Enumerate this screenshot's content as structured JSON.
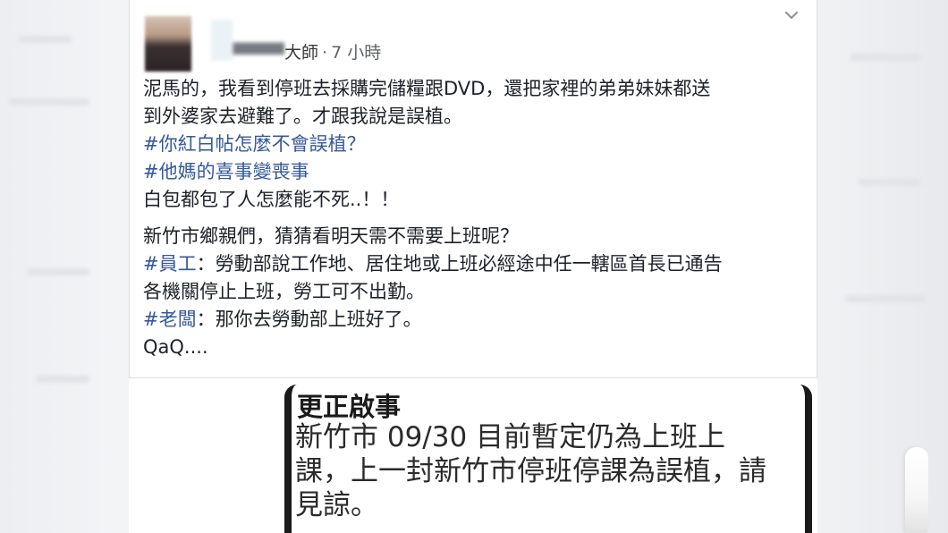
{
  "post": {
    "author_suffix": "大師",
    "separator": "·",
    "time": "7 小時",
    "lines": [
      "泥馬的，我看到停班去採購完儲糧跟DVD，還把家裡的弟弟妹妹都送",
      "到外婆家去避難了。才跟我說是誤植。"
    ],
    "hashtag1": "#你紅白帖怎麼不會誤植？",
    "hashtag2": "#他媽的喜事變喪事",
    "line_after_tags": "白包都包了人怎麼能不死..！！",
    "para2_line1": "新竹市鄉親們，猜猜看明天需不需要上班呢？",
    "employee_tag": "#員工",
    "employee_text_line1": "：勞動部說工作地、居住地或上班必經途中任一轄區首長已通告",
    "employee_text_line2": "各機關停止上班，勞工可不出勤。",
    "boss_tag": "#老闆",
    "boss_text": "：那你去勞動部上班好了。",
    "closing": "QaQ...."
  },
  "notice": {
    "title": "更正啟事",
    "lines": [
      "新竹市 09/30 目前暫定仍為上班上",
      "課，上一封新竹市停班停課為誤植，請",
      "見諒。"
    ]
  },
  "icons": {
    "options": "chevron-down-icon"
  }
}
